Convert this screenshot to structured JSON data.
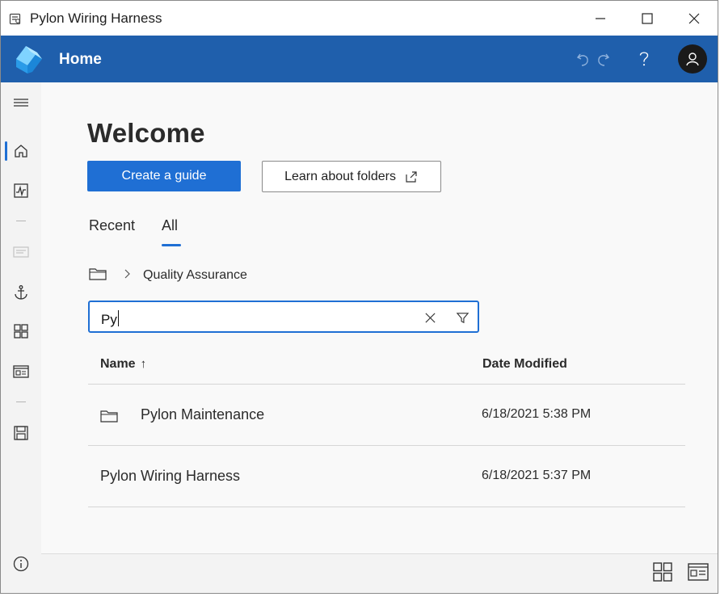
{
  "window": {
    "title": "Pylon Wiring Harness"
  },
  "header": {
    "title": "Home",
    "colors": {
      "bar": "#1f5fac",
      "accent": "#1f6fd4"
    }
  },
  "sidebar": {
    "items": [
      {
        "icon": "hamburger-menu-icon"
      },
      {
        "icon": "home-icon",
        "active": true
      },
      {
        "icon": "activity-chart-icon"
      },
      {
        "icon": "document-icon",
        "disabled": true
      },
      {
        "icon": "anchor-icon"
      },
      {
        "icon": "grid-icon"
      },
      {
        "icon": "card-view-icon"
      },
      {
        "icon": "save-icon"
      },
      {
        "icon": "info-icon"
      }
    ]
  },
  "main": {
    "welcome": "Welcome",
    "create_button": "Create a guide",
    "learn_button": "Learn about folders",
    "tabs": [
      {
        "label": "Recent",
        "active": false
      },
      {
        "label": "All",
        "active": true
      }
    ],
    "breadcrumb": [
      "Quality Assurance"
    ],
    "search": {
      "value": "Py"
    },
    "columns": {
      "name": "Name",
      "sort_arrow": "↑",
      "date": "Date Modified"
    },
    "rows": [
      {
        "name": "Pylon Maintenance",
        "date": "6/18/2021 5:38 PM",
        "type": "folder"
      },
      {
        "name": "Pylon Wiring Harness",
        "date": "6/18/2021 5:37 PM",
        "type": "guide"
      }
    ]
  },
  "footer": {
    "icons": [
      "grid-view-icon",
      "card-view-icon"
    ]
  }
}
